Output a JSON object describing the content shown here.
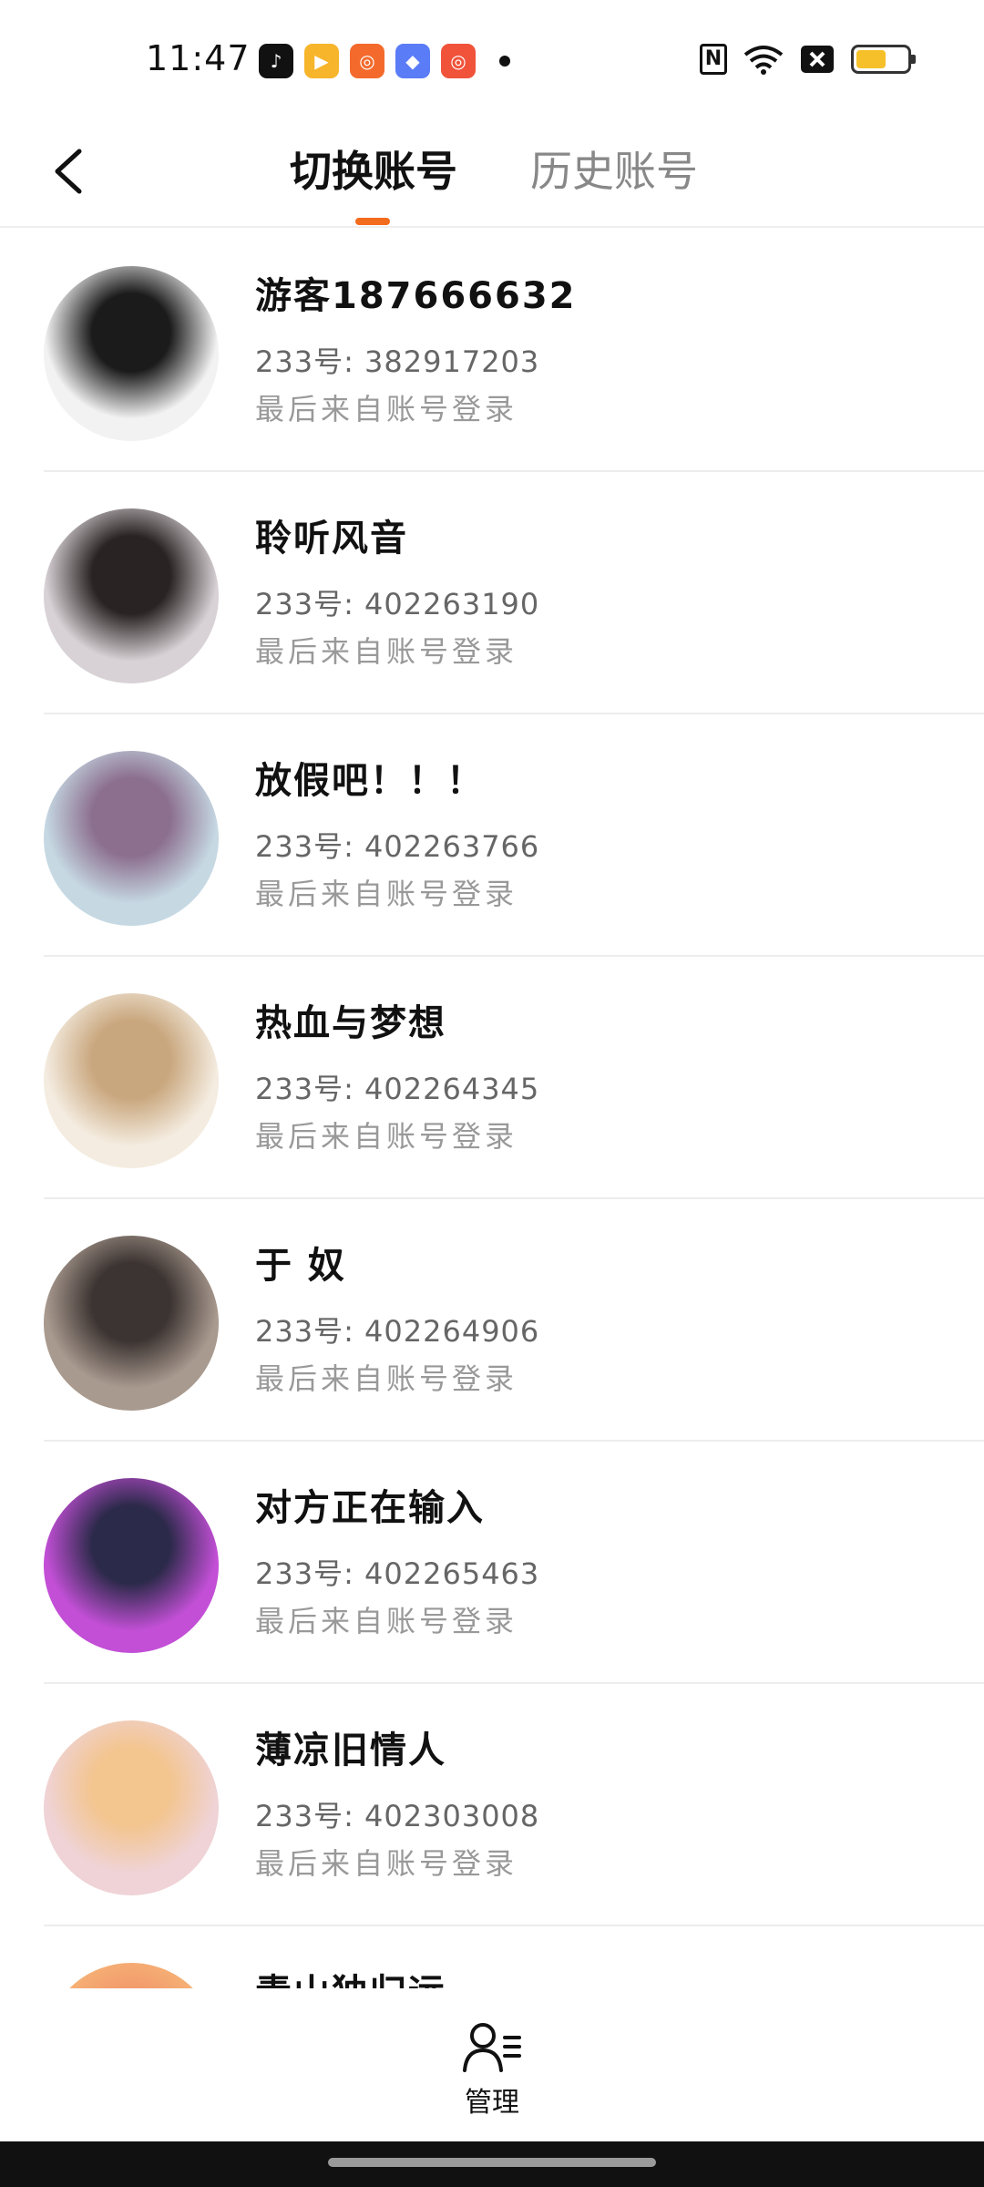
{
  "status_bar": {
    "time": "11:47",
    "app_icons": [
      {
        "name": "douyin-icon",
        "color": "#111111",
        "glyph": "♪"
      },
      {
        "name": "video-app-icon",
        "color": "#f7b52c",
        "glyph": "▶"
      },
      {
        "name": "kuaishou-icon",
        "color": "#f46a2c",
        "glyph": "◎"
      },
      {
        "name": "shortcut-app-icon",
        "color": "#5b7cf7",
        "glyph": "◆"
      },
      {
        "name": "kuaishou-lite-icon",
        "color": "#f0533a",
        "glyph": "◎"
      }
    ],
    "battery_color": "#f5c02a"
  },
  "header": {
    "tabs": [
      {
        "label": "切换账号",
        "active": true
      },
      {
        "label": "历史账号",
        "active": false
      }
    ],
    "accent": "#f36b1c"
  },
  "accounts": [
    {
      "name": "游客187666632",
      "uid": "233号: 382917203",
      "last_login": "最后来自账号登录",
      "avatar_colors": [
        "#f2f2f2",
        "#1b1b1b"
      ]
    },
    {
      "name": "聆听风音",
      "uid": "233号: 402263190",
      "last_login": "最后来自账号登录",
      "avatar_colors": [
        "#d8d2d6",
        "#2a2323"
      ]
    },
    {
      "name": "放假吧！！！",
      "uid": "233号: 402263766",
      "last_login": "最后来自账号登录",
      "avatar_colors": [
        "#c6d9e3",
        "#8c6f8f"
      ]
    },
    {
      "name": "热血与梦想",
      "uid": "233号: 402264345",
      "last_login": "最后来自账号登录",
      "avatar_colors": [
        "#f4ece0",
        "#c9a77e"
      ]
    },
    {
      "name": "于 奴",
      "uid": "233号: 402264906",
      "last_login": "最后来自账号登录",
      "avatar_colors": [
        "#a99a8f",
        "#3c3432"
      ]
    },
    {
      "name": "对方正在输入",
      "uid": "233号: 402265463",
      "last_login": "最后来自账号登录",
      "avatar_colors": [
        "#c24fd6",
        "#2c2a4a"
      ]
    },
    {
      "name": "薄凉旧情人",
      "uid": "233号: 402303008",
      "last_login": "最后来自账号登录",
      "avatar_colors": [
        "#efd3d6",
        "#f3c58f"
      ]
    },
    {
      "name": "青山独归远",
      "uid": "",
      "last_login": "",
      "avatar_colors": [
        "#f7b979",
        "#f29a6b"
      ]
    }
  ],
  "bottom": {
    "manage_label": "管理"
  }
}
